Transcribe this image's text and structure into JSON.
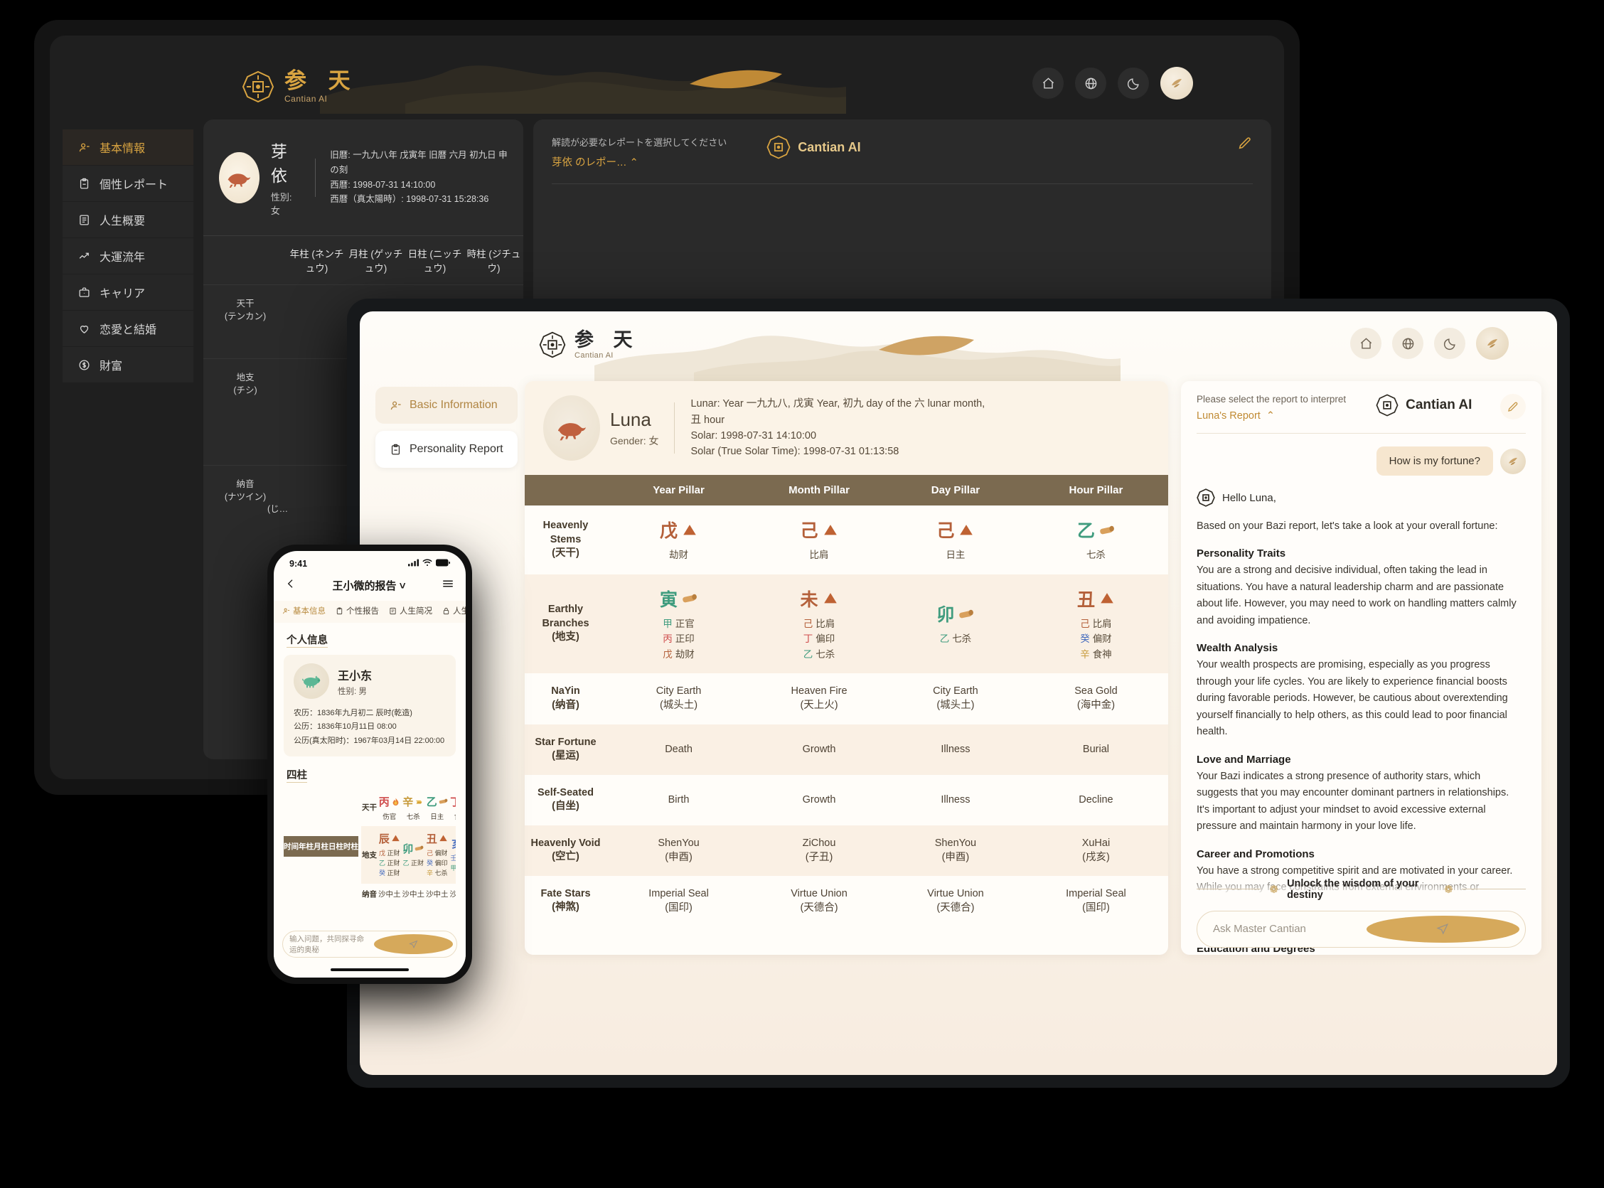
{
  "brand": {
    "cn": "参 天",
    "en": "Cantian AI"
  },
  "dark_tablet": {
    "nav": {
      "home": "home-icon",
      "globe": "globe-icon",
      "moon": "moon-icon",
      "avatar": "user-avatar"
    },
    "sidebar": [
      {
        "label": "基本情報",
        "icon": "user-icon"
      },
      {
        "label": "個性レポート",
        "icon": "clipboard-icon"
      },
      {
        "label": "人生概要",
        "icon": "document-icon"
      },
      {
        "label": "大運流年",
        "icon": "trending-up-icon"
      },
      {
        "label": "キャリア",
        "icon": "briefcase-icon"
      },
      {
        "label": "恋愛と結婚",
        "icon": "heart-icon"
      },
      {
        "label": "財富",
        "icon": "dollar-icon"
      }
    ],
    "person": {
      "name": "芽依",
      "gender": "性別: 女",
      "lunar": "旧暦: 一九九八年 戊寅年 旧暦 六月 初九日 申の刻",
      "solar": "西暦:  1998-07-31 14:10:00",
      "true_solar": "西暦（真太陽時）: 1998-07-31 15:28:36"
    },
    "pillars": [
      "年柱 (ネンチュウ)",
      "月柱 (ゲッチュウ)",
      "日柱 (ニッチュウ)",
      "時柱 (ジチュウ)"
    ],
    "rows": [
      "天干\n(テンカン)",
      "地支\n(チシ)",
      "納音\n(ナツイン)"
    ],
    "row_labels": [
      {
        "l1": "天干",
        "l2": "(テンカン)"
      },
      {
        "l1": "地支",
        "l2": "(チシ)"
      },
      {
        "l1": "納音",
        "l2": "(ナツイン)"
      }
    ],
    "nayin_hint": "(じ…",
    "ai": {
      "select_hint": "解読が必要なレポートを選択してください",
      "select_value": "芽依 のレポー…",
      "brand": "Cantian AI",
      "pen": "pen-icon"
    },
    "trash": "trash-icon"
  },
  "light_tablet": {
    "nav": {
      "home": "home-icon",
      "globe": "globe-icon",
      "moon": "moon-icon",
      "avatar": "user-avatar"
    },
    "sidebar": [
      {
        "label": "Basic Information",
        "icon": "user-icon"
      },
      {
        "label": "Personality Report",
        "icon": "clipboard-icon"
      }
    ],
    "person": {
      "name": "Luna",
      "gender": "Gender: 女",
      "lunar": "Lunar: Year 一九九八, 戊寅 Year, 初九 day of the 六 lunar month, 丑 hour",
      "solar": "Solar: 1998-07-31 14:10:00",
      "true_solar": "Solar (True Solar Time): 1998-07-31 01:13:58"
    },
    "table": {
      "headers": [
        "",
        "Year Pillar",
        "Month Pillar",
        "Day Pillar",
        "Hour Pillar"
      ],
      "rows": [
        {
          "label": "Heavenly Stems",
          "label_cn": "(天干)",
          "kind": "stems",
          "cells": [
            {
              "char": "戊",
              "element": "earth",
              "god": "劫财"
            },
            {
              "char": "己",
              "element": "earth",
              "god": "比肩"
            },
            {
              "char": "己",
              "element": "earth",
              "god": "日主"
            },
            {
              "char": "乙",
              "element": "wood",
              "god": "七杀"
            }
          ]
        },
        {
          "label": "Earthly Branches",
          "label_cn": "(地支)",
          "kind": "branches",
          "cells": [
            {
              "char": "寅",
              "element": "wood",
              "hidden": [
                {
                  "k": "甲",
                  "e": "wood",
                  "g": "正官"
                },
                {
                  "k": "丙",
                  "e": "fire",
                  "g": "正印"
                },
                {
                  "k": "戊",
                  "e": "earth",
                  "g": "劫财"
                }
              ]
            },
            {
              "char": "未",
              "element": "earth",
              "hidden": [
                {
                  "k": "己",
                  "e": "earth",
                  "g": "比肩"
                },
                {
                  "k": "丁",
                  "e": "fire",
                  "g": "偏印"
                },
                {
                  "k": "乙",
                  "e": "wood",
                  "g": "七杀"
                }
              ]
            },
            {
              "char": "卯",
              "element": "wood",
              "hidden": [
                {
                  "k": "乙",
                  "e": "wood",
                  "g": "七杀"
                }
              ]
            },
            {
              "char": "丑",
              "element": "earth",
              "hidden": [
                {
                  "k": "己",
                  "e": "earth",
                  "g": "比肩"
                },
                {
                  "k": "癸",
                  "e": "water",
                  "g": "偏财"
                },
                {
                  "k": "辛",
                  "e": "metal",
                  "g": "食神"
                }
              ]
            }
          ]
        },
        {
          "label": "NaYin",
          "label_cn": "(纳音)",
          "kind": "pair",
          "cells": [
            {
              "en": "City Earth",
              "cn": "(城头土)"
            },
            {
              "en": "Heaven Fire",
              "cn": "(天上火)"
            },
            {
              "en": "City Earth",
              "cn": "(城头土)"
            },
            {
              "en": "Sea Gold",
              "cn": "(海中金)"
            }
          ]
        },
        {
          "label": "Star Fortune",
          "label_cn": "(星运)",
          "kind": "plain",
          "cells": [
            {
              "en": "Death"
            },
            {
              "en": "Growth"
            },
            {
              "en": "Illness"
            },
            {
              "en": "Burial"
            }
          ]
        },
        {
          "label": "Self-Seated",
          "label_cn": "(自坐)",
          "kind": "plain",
          "cells": [
            {
              "en": "Birth"
            },
            {
              "en": "Growth"
            },
            {
              "en": "Illness"
            },
            {
              "en": "Decline"
            }
          ]
        },
        {
          "label": "Heavenly Void",
          "label_cn": "(空亡)",
          "kind": "pair",
          "cells": [
            {
              "en": "ShenYou",
              "cn": "(申酉)"
            },
            {
              "en": "ZiChou",
              "cn": "(子丑)"
            },
            {
              "en": "ShenYou",
              "cn": "(申酉)"
            },
            {
              "en": "XuHai",
              "cn": "(戌亥)"
            }
          ]
        },
        {
          "label": "Fate Stars",
          "label_cn": "(神煞)",
          "kind": "pair",
          "cells": [
            {
              "en": "Imperial Seal",
              "cn": "(国印)"
            },
            {
              "en": "Virtue Union",
              "cn": "(天德合)"
            },
            {
              "en": "Virtue Union",
              "cn": "(天德合)"
            },
            {
              "en": "Imperial Seal",
              "cn": "(国印)"
            }
          ]
        }
      ]
    },
    "ai": {
      "select_hint": "Please select the report to interpret",
      "select_value": "Luna's Report",
      "brand": "Cantian AI",
      "user_message": "How is my fortune?",
      "greeting": "Hello Luna,",
      "intro": "Based on your Bazi report, let's take a look at your overall fortune:",
      "sections": [
        {
          "title": "Personality Traits",
          "body": "You are a strong and decisive individual, often taking the lead in situations. You have a natural leadership charm and are passionate about life. However, you may need to work on handling matters calmly and avoiding impatience."
        },
        {
          "title": "Wealth Analysis",
          "body": "Your wealth prospects are promising, especially as you progress through your life cycles. You are likely to experience financial boosts during favorable periods. However, be cautious about overextending yourself financially to help others, as this could lead to poor financial health."
        },
        {
          "title": "Love and Marriage",
          "body": "Your Bazi indicates a strong presence of authority stars, which suggests that you may encounter dominant partners in relationships. It's important to adjust your mindset to avoid excessive external pressure and maintain harmony in your love life."
        },
        {
          "title": "Career and Promotions",
          "body": "You have a strong competitive spirit and are motivated in your career. While you may face constraints from external environments or superiors, promotion opportunities are frequent. It's crucial to manage the pressure to avoid exhaustion."
        },
        {
          "title": "Education and Degrees",
          "body": ""
        }
      ],
      "unlock": "Unlock the wisdom of your destiny",
      "input_placeholder": "Ask Master Cantian",
      "send": "send-icon"
    }
  },
  "phone": {
    "status": {
      "time": "9:41",
      "signal": "signal-icon",
      "wifi": "wifi-icon",
      "battery": "battery-icon"
    },
    "nav": {
      "back": "back-chevron-icon",
      "title": "王小微的报告",
      "caret": "chevron-down-icon",
      "menu": "hamburger-menu-icon"
    },
    "tabs": [
      {
        "label": "基本信息",
        "icon": "user-icon",
        "active": true
      },
      {
        "label": "个性报告",
        "icon": "clipboard-icon",
        "active": false
      },
      {
        "label": "人生简况",
        "icon": "document-icon",
        "active": false
      },
      {
        "label": "人生精",
        "icon": "lock-icon",
        "active": false
      }
    ],
    "section1": "个人信息",
    "person": {
      "name": "王小东",
      "gender": "性别: 男",
      "lunar": "农历：1836年九月初二 辰时(乾造)",
      "solar": "公历：1836年10月11日 08:00",
      "true_solar": "公历(真太阳时)：1967年03月14日 22:00:00"
    },
    "section2": "四柱",
    "table": {
      "headers": [
        "时间",
        "年柱",
        "月柱",
        "日柱",
        "时柱"
      ],
      "rows": [
        {
          "label": "天干",
          "kind": "stems",
          "cells": [
            {
              "char": "丙",
              "element": "fire",
              "god": "伤官"
            },
            {
              "char": "辛",
              "element": "metal",
              "god": "七杀"
            },
            {
              "char": "乙",
              "element": "wood",
              "god": "日主"
            },
            {
              "char": "丁",
              "element": "fire",
              "god": "食神"
            }
          ]
        },
        {
          "label": "地支",
          "kind": "branches",
          "cells": [
            {
              "char": "辰",
              "element": "earth",
              "hidden": [
                {
                  "k": "戊",
                  "e": "earth",
                  "g": "正财"
                },
                {
                  "k": "乙",
                  "e": "wood",
                  "g": "正财"
                },
                {
                  "k": "癸",
                  "e": "water",
                  "g": "正财"
                }
              ]
            },
            {
              "char": "卯",
              "element": "wood",
              "hidden": [
                {
                  "k": "乙",
                  "e": "wood",
                  "g": "正财"
                }
              ]
            },
            {
              "char": "丑",
              "element": "earth",
              "hidden": [
                {
                  "k": "己",
                  "e": "earth",
                  "g": "偏财"
                },
                {
                  "k": "癸",
                  "e": "water",
                  "g": "偏印"
                },
                {
                  "k": "辛",
                  "e": "metal",
                  "g": "七杀"
                }
              ]
            },
            {
              "char": "亥",
              "element": "water",
              "hidden": [
                {
                  "k": "壬",
                  "e": "water",
                  "g": "正财"
                },
                {
                  "k": "甲",
                  "e": "wood",
                  "g": "劫财"
                }
              ]
            }
          ]
        },
        {
          "label": "纳音",
          "kind": "plain",
          "cells": [
            {
              "en": "沙中土"
            },
            {
              "en": "沙中土"
            },
            {
              "en": "沙中土"
            },
            {
              "en": "沙中土"
            }
          ]
        }
      ]
    },
    "input_placeholder": "输入问题，共同探寻命运的奥秘",
    "send": "send-icon"
  },
  "colors": {
    "gold": "#d9a441",
    "gold_light": "#c08a33",
    "earth": "#b4603a",
    "wood": "#3f9c7e",
    "fire": "#cf4b4b",
    "metal": "#c79a3a",
    "water": "#4a6fbf",
    "header_brown": "#7b6a50"
  }
}
